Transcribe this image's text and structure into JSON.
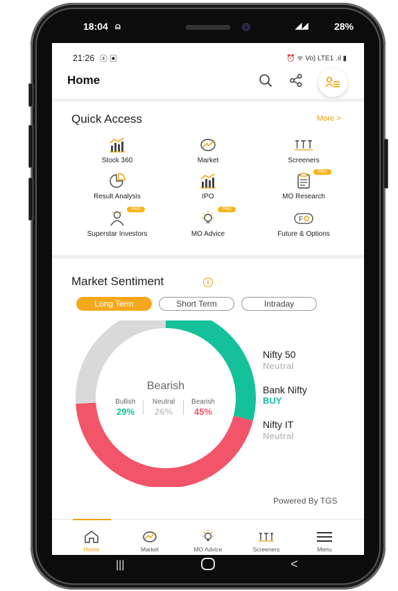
{
  "device": {
    "time": "18:04",
    "battery": "28%"
  },
  "status": {
    "time": "21:26",
    "right_icons": "⏰ ᯤ Vo) LTE1 .ıl ▮"
  },
  "header": {
    "title": "Home"
  },
  "quick_access": {
    "title": "Quick Access",
    "more": "More >",
    "items": [
      {
        "label": "Stock 360",
        "icon": "bar-chart-icon",
        "pro": false
      },
      {
        "label": "Market",
        "icon": "market-icon",
        "pro": false
      },
      {
        "label": "Screeners",
        "icon": "screener-icon",
        "pro": false
      },
      {
        "label": "Result Analysis",
        "icon": "pie-chart-icon",
        "pro": false
      },
      {
        "label": "IPO",
        "icon": "bar-chart-icon",
        "pro": false
      },
      {
        "label": "MO Research",
        "icon": "clipboard-icon",
        "pro": true
      },
      {
        "label": "Superstar Investors",
        "icon": "investor-icon",
        "pro": true
      },
      {
        "label": "MO Advice",
        "icon": "bulb-icon",
        "pro": true
      },
      {
        "label": "Future & Options",
        "icon": "fo-icon",
        "pro": false
      }
    ],
    "pro_badge": "PRO"
  },
  "sentiment": {
    "title": "Market Sentiment",
    "info_icon": "i",
    "tabs": [
      "Long Term",
      "Short Term",
      "Intraday"
    ],
    "active_tab": 0,
    "center_label": "Bearish",
    "bullish_label": "Bullish",
    "neutral_label": "Neutral",
    "bearish_label": "Bearish",
    "bullish_pct": "29%",
    "neutral_pct": "26%",
    "bearish_pct": "45%",
    "colors": {
      "bullish": "#14c19a",
      "neutral": "#d9d9d9",
      "bearish": "#f2546a"
    },
    "indices": [
      {
        "name": "Nifty 50",
        "value": "Neutral",
        "color": "#c4c4c4"
      },
      {
        "name": "Bank Nifty",
        "value": "BUY",
        "color": "#14c19a"
      },
      {
        "name": "Nifty IT",
        "value": "Neutral",
        "color": "#c4c4c4"
      }
    ],
    "powered_by": "Powered By TGS"
  },
  "chart_data": {
    "type": "pie",
    "title": "",
    "categories": [
      "Bullish",
      "Neutral",
      "Bearish"
    ],
    "values": [
      29,
      26,
      45
    ],
    "colors": [
      "#14c19a",
      "#d9d9d9",
      "#f2546a"
    ]
  },
  "bottom_nav": [
    {
      "label": "Home",
      "icon": "home-icon",
      "active": true
    },
    {
      "label": "Market",
      "icon": "market-icon",
      "active": false
    },
    {
      "label": "MO Advice",
      "icon": "bulb-icon",
      "active": false
    },
    {
      "label": "Screeners",
      "icon": "screener-icon",
      "active": false
    },
    {
      "label": "Menu",
      "icon": "hamburger-icon",
      "active": false
    }
  ],
  "accent": "#f0a000"
}
